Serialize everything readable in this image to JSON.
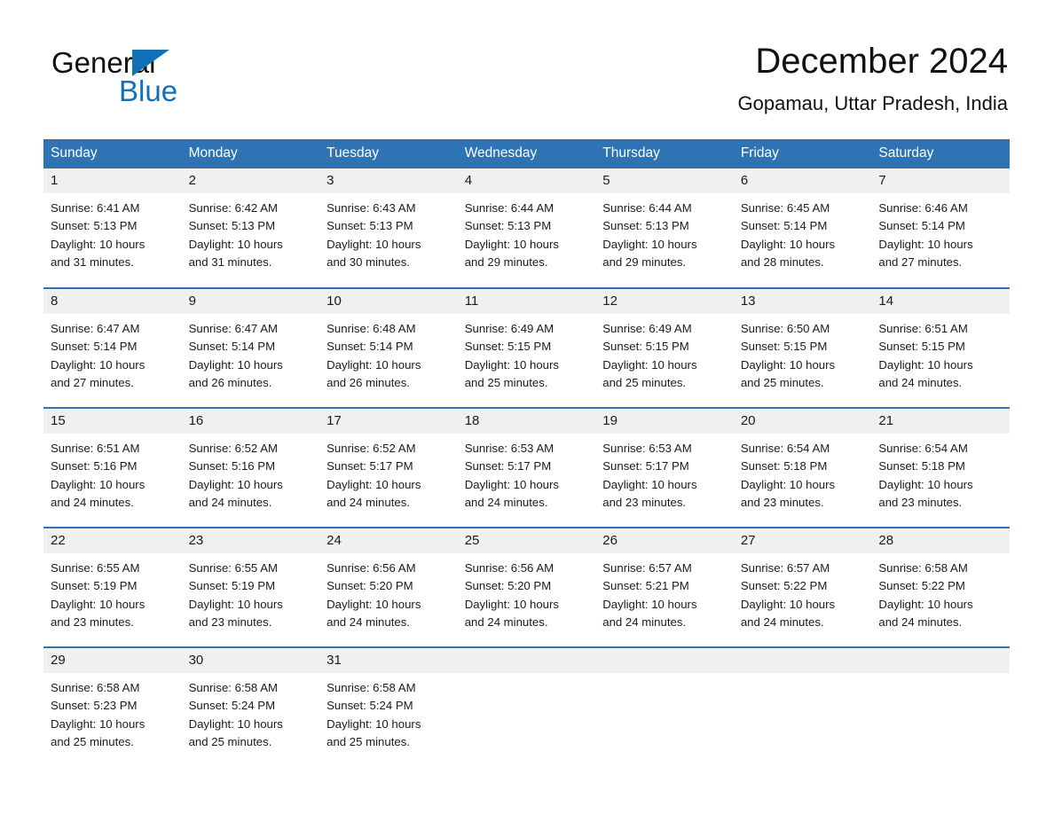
{
  "brand": {
    "name_part1": "General",
    "name_part2": "Blue",
    "accent_color": "#1270b8",
    "triangle_icon": "triangle-icon"
  },
  "header": {
    "title": "December 2024",
    "location": "Gopamau, Uttar Pradesh, India"
  },
  "theme": {
    "header_blue": "#2e74b5",
    "daynum_bg": "#f0f0f0",
    "text": "#1b1b1b"
  },
  "calendar": {
    "weekday_headers": [
      "Sunday",
      "Monday",
      "Tuesday",
      "Wednesday",
      "Thursday",
      "Friday",
      "Saturday"
    ],
    "weeks": [
      [
        {
          "day": "1",
          "sunrise": "Sunrise: 6:41 AM",
          "sunset": "Sunset: 5:13 PM",
          "daylight_line1": "Daylight: 10 hours",
          "daylight_line2": "and 31 minutes."
        },
        {
          "day": "2",
          "sunrise": "Sunrise: 6:42 AM",
          "sunset": "Sunset: 5:13 PM",
          "daylight_line1": "Daylight: 10 hours",
          "daylight_line2": "and 31 minutes."
        },
        {
          "day": "3",
          "sunrise": "Sunrise: 6:43 AM",
          "sunset": "Sunset: 5:13 PM",
          "daylight_line1": "Daylight: 10 hours",
          "daylight_line2": "and 30 minutes."
        },
        {
          "day": "4",
          "sunrise": "Sunrise: 6:44 AM",
          "sunset": "Sunset: 5:13 PM",
          "daylight_line1": "Daylight: 10 hours",
          "daylight_line2": "and 29 minutes."
        },
        {
          "day": "5",
          "sunrise": "Sunrise: 6:44 AM",
          "sunset": "Sunset: 5:13 PM",
          "daylight_line1": "Daylight: 10 hours",
          "daylight_line2": "and 29 minutes."
        },
        {
          "day": "6",
          "sunrise": "Sunrise: 6:45 AM",
          "sunset": "Sunset: 5:14 PM",
          "daylight_line1": "Daylight: 10 hours",
          "daylight_line2": "and 28 minutes."
        },
        {
          "day": "7",
          "sunrise": "Sunrise: 6:46 AM",
          "sunset": "Sunset: 5:14 PM",
          "daylight_line1": "Daylight: 10 hours",
          "daylight_line2": "and 27 minutes."
        }
      ],
      [
        {
          "day": "8",
          "sunrise": "Sunrise: 6:47 AM",
          "sunset": "Sunset: 5:14 PM",
          "daylight_line1": "Daylight: 10 hours",
          "daylight_line2": "and 27 minutes."
        },
        {
          "day": "9",
          "sunrise": "Sunrise: 6:47 AM",
          "sunset": "Sunset: 5:14 PM",
          "daylight_line1": "Daylight: 10 hours",
          "daylight_line2": "and 26 minutes."
        },
        {
          "day": "10",
          "sunrise": "Sunrise: 6:48 AM",
          "sunset": "Sunset: 5:14 PM",
          "daylight_line1": "Daylight: 10 hours",
          "daylight_line2": "and 26 minutes."
        },
        {
          "day": "11",
          "sunrise": "Sunrise: 6:49 AM",
          "sunset": "Sunset: 5:15 PM",
          "daylight_line1": "Daylight: 10 hours",
          "daylight_line2": "and 25 minutes."
        },
        {
          "day": "12",
          "sunrise": "Sunrise: 6:49 AM",
          "sunset": "Sunset: 5:15 PM",
          "daylight_line1": "Daylight: 10 hours",
          "daylight_line2": "and 25 minutes."
        },
        {
          "day": "13",
          "sunrise": "Sunrise: 6:50 AM",
          "sunset": "Sunset: 5:15 PM",
          "daylight_line1": "Daylight: 10 hours",
          "daylight_line2": "and 25 minutes."
        },
        {
          "day": "14",
          "sunrise": "Sunrise: 6:51 AM",
          "sunset": "Sunset: 5:15 PM",
          "daylight_line1": "Daylight: 10 hours",
          "daylight_line2": "and 24 minutes."
        }
      ],
      [
        {
          "day": "15",
          "sunrise": "Sunrise: 6:51 AM",
          "sunset": "Sunset: 5:16 PM",
          "daylight_line1": "Daylight: 10 hours",
          "daylight_line2": "and 24 minutes."
        },
        {
          "day": "16",
          "sunrise": "Sunrise: 6:52 AM",
          "sunset": "Sunset: 5:16 PM",
          "daylight_line1": "Daylight: 10 hours",
          "daylight_line2": "and 24 minutes."
        },
        {
          "day": "17",
          "sunrise": "Sunrise: 6:52 AM",
          "sunset": "Sunset: 5:17 PM",
          "daylight_line1": "Daylight: 10 hours",
          "daylight_line2": "and 24 minutes."
        },
        {
          "day": "18",
          "sunrise": "Sunrise: 6:53 AM",
          "sunset": "Sunset: 5:17 PM",
          "daylight_line1": "Daylight: 10 hours",
          "daylight_line2": "and 24 minutes."
        },
        {
          "day": "19",
          "sunrise": "Sunrise: 6:53 AM",
          "sunset": "Sunset: 5:17 PM",
          "daylight_line1": "Daylight: 10 hours",
          "daylight_line2": "and 23 minutes."
        },
        {
          "day": "20",
          "sunrise": "Sunrise: 6:54 AM",
          "sunset": "Sunset: 5:18 PM",
          "daylight_line1": "Daylight: 10 hours",
          "daylight_line2": "and 23 minutes."
        },
        {
          "day": "21",
          "sunrise": "Sunrise: 6:54 AM",
          "sunset": "Sunset: 5:18 PM",
          "daylight_line1": "Daylight: 10 hours",
          "daylight_line2": "and 23 minutes."
        }
      ],
      [
        {
          "day": "22",
          "sunrise": "Sunrise: 6:55 AM",
          "sunset": "Sunset: 5:19 PM",
          "daylight_line1": "Daylight: 10 hours",
          "daylight_line2": "and 23 minutes."
        },
        {
          "day": "23",
          "sunrise": "Sunrise: 6:55 AM",
          "sunset": "Sunset: 5:19 PM",
          "daylight_line1": "Daylight: 10 hours",
          "daylight_line2": "and 23 minutes."
        },
        {
          "day": "24",
          "sunrise": "Sunrise: 6:56 AM",
          "sunset": "Sunset: 5:20 PM",
          "daylight_line1": "Daylight: 10 hours",
          "daylight_line2": "and 24 minutes."
        },
        {
          "day": "25",
          "sunrise": "Sunrise: 6:56 AM",
          "sunset": "Sunset: 5:20 PM",
          "daylight_line1": "Daylight: 10 hours",
          "daylight_line2": "and 24 minutes."
        },
        {
          "day": "26",
          "sunrise": "Sunrise: 6:57 AM",
          "sunset": "Sunset: 5:21 PM",
          "daylight_line1": "Daylight: 10 hours",
          "daylight_line2": "and 24 minutes."
        },
        {
          "day": "27",
          "sunrise": "Sunrise: 6:57 AM",
          "sunset": "Sunset: 5:22 PM",
          "daylight_line1": "Daylight: 10 hours",
          "daylight_line2": "and 24 minutes."
        },
        {
          "day": "28",
          "sunrise": "Sunrise: 6:58 AM",
          "sunset": "Sunset: 5:22 PM",
          "daylight_line1": "Daylight: 10 hours",
          "daylight_line2": "and 24 minutes."
        }
      ],
      [
        {
          "day": "29",
          "sunrise": "Sunrise: 6:58 AM",
          "sunset": "Sunset: 5:23 PM",
          "daylight_line1": "Daylight: 10 hours",
          "daylight_line2": "and 25 minutes."
        },
        {
          "day": "30",
          "sunrise": "Sunrise: 6:58 AM",
          "sunset": "Sunset: 5:24 PM",
          "daylight_line1": "Daylight: 10 hours",
          "daylight_line2": "and 25 minutes."
        },
        {
          "day": "31",
          "sunrise": "Sunrise: 6:58 AM",
          "sunset": "Sunset: 5:24 PM",
          "daylight_line1": "Daylight: 10 hours",
          "daylight_line2": "and 25 minutes."
        },
        {
          "day": "",
          "sunrise": "",
          "sunset": "",
          "daylight_line1": "",
          "daylight_line2": ""
        },
        {
          "day": "",
          "sunrise": "",
          "sunset": "",
          "daylight_line1": "",
          "daylight_line2": ""
        },
        {
          "day": "",
          "sunrise": "",
          "sunset": "",
          "daylight_line1": "",
          "daylight_line2": ""
        },
        {
          "day": "",
          "sunrise": "",
          "sunset": "",
          "daylight_line1": "",
          "daylight_line2": ""
        }
      ]
    ]
  }
}
